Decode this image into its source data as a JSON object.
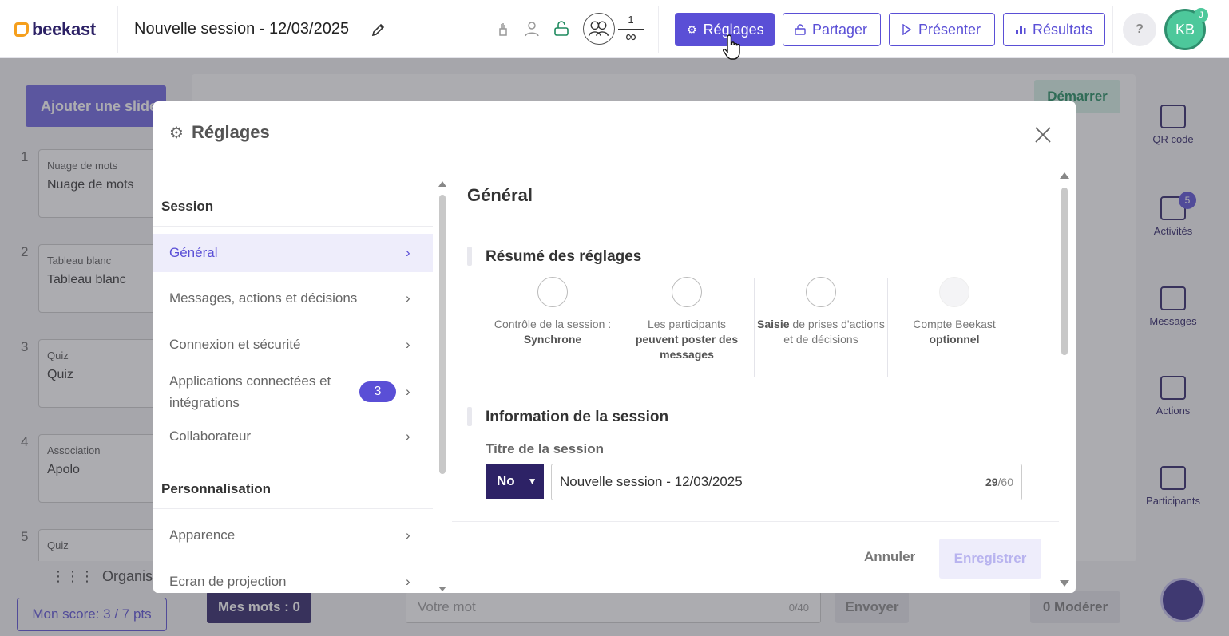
{
  "app": {
    "logo": "beekast",
    "session_title": "Nouvelle session - 12/03/2025",
    "participants_count": "1",
    "participants_limit": "∞",
    "colors": {
      "brand": "#5a4fd6",
      "dark": "#2d2266",
      "logo_accent": "#f59f1d",
      "avatar": "#4dc89b"
    }
  },
  "toolbar": {
    "reglages": "Réglages",
    "partager": "Partager",
    "presenter": "Présenter",
    "resultats": "Résultats",
    "help": "?",
    "avatar_initials": "KB",
    "avatar_small": "J"
  },
  "background": {
    "add_slide": "Ajouter une slide",
    "slides": [
      {
        "num": "1",
        "type": "Nuage de mots",
        "name": "Nuage de mots"
      },
      {
        "num": "2",
        "type": "Tableau blanc",
        "name": "Tableau blanc"
      },
      {
        "num": "3",
        "type": "Quiz",
        "name": "Quiz"
      },
      {
        "num": "4",
        "type": "Association",
        "name": "Apolo"
      },
      {
        "num": "5",
        "type": "Quiz",
        "name": ""
      }
    ],
    "demarrer": "Démarrer",
    "right_sidebar": [
      {
        "label": "QR code",
        "icon": "qr-code-icon"
      },
      {
        "label": "Activités",
        "icon": "activities-icon",
        "badge": "5"
      },
      {
        "label": "Messages",
        "icon": "messages-icon"
      },
      {
        "label": "Actions",
        "icon": "actions-icon"
      },
      {
        "label": "Participants",
        "icon": "participants-icon"
      }
    ],
    "organiser": "Organiser",
    "mon_score": "Mon score: 3 / 7 pts",
    "mes_mots": "Mes mots : 0",
    "votre_mot_placeholder": "Votre mot",
    "votre_mot_count": "0/40",
    "envoyer": "Envoyer",
    "moderer": "0 Modérer"
  },
  "modal": {
    "title": "Réglages",
    "nav": {
      "section1": "Session",
      "items1": [
        {
          "label": "Général"
        },
        {
          "label": "Messages, actions et décisions"
        },
        {
          "label": "Connexion et sécurité"
        },
        {
          "label": "Applications connectées et intégrations",
          "badge": "3"
        },
        {
          "label": "Collaborateur"
        }
      ],
      "section2": "Personnalisation",
      "items2": [
        {
          "label": "Apparence"
        },
        {
          "label": "Ecran de projection"
        }
      ]
    },
    "content": {
      "title": "Général",
      "summary_title": "Résumé des réglages",
      "summary": [
        {
          "icon": "session-control-icon",
          "pre": "Contrôle de la session :",
          "bold": "Synchrone",
          "post": ""
        },
        {
          "icon": "messages-icon",
          "pre": "Les participants",
          "bold": "peuvent poster des messages",
          "post": ""
        },
        {
          "icon": "actions-check-icon",
          "pre": "",
          "bold": "Saisie",
          "post": "de prises d'actions et de décisions"
        },
        {
          "icon": "account-icon",
          "pre": "Compte Beekast",
          "bold": "optionnel",
          "post": ""
        }
      ],
      "info_title": "Information de la session",
      "field_label": "Titre de la session",
      "lang": "No",
      "title_value": "Nouvelle session - 12/03/2025",
      "char_count": "29",
      "char_max": "/60"
    },
    "footer": {
      "annuler": "Annuler",
      "enregistrer": "Enregistrer"
    }
  }
}
